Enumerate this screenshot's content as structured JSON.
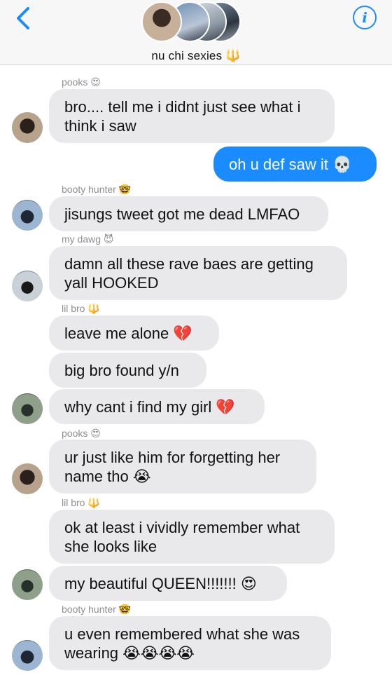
{
  "header": {
    "group_name": "nu chi sexies 🔱"
  },
  "messages": [
    {
      "sender": "pooks 😍",
      "text": "bro.... tell me i didnt just see what i think i saw"
    },
    {
      "text": "oh u def saw it 💀"
    },
    {
      "sender": "booty hunter 🤓",
      "text": "jisungs tweet got me dead LMFAO"
    },
    {
      "sender": "my dawg 😈",
      "text": "damn all these rave baes are getting yall HOOKED"
    },
    {
      "sender": "lil bro 🔱",
      "text": "leave me alone 💔"
    },
    {
      "text": "big bro found y/n"
    },
    {
      "text": "why cant i find my girl 💔"
    },
    {
      "sender": "pooks 😍",
      "text": "ur just like him for forgetting her name tho 😭"
    },
    {
      "sender": "lil bro 🔱",
      "text": "ok at least i vividly remember what she looks like"
    },
    {
      "text": "my beautiful QUEEN!!!!!!! 😍"
    },
    {
      "sender": "booty hunter 🤓",
      "text": "u even remembered what she was wearing 😭😭😭😭"
    }
  ]
}
